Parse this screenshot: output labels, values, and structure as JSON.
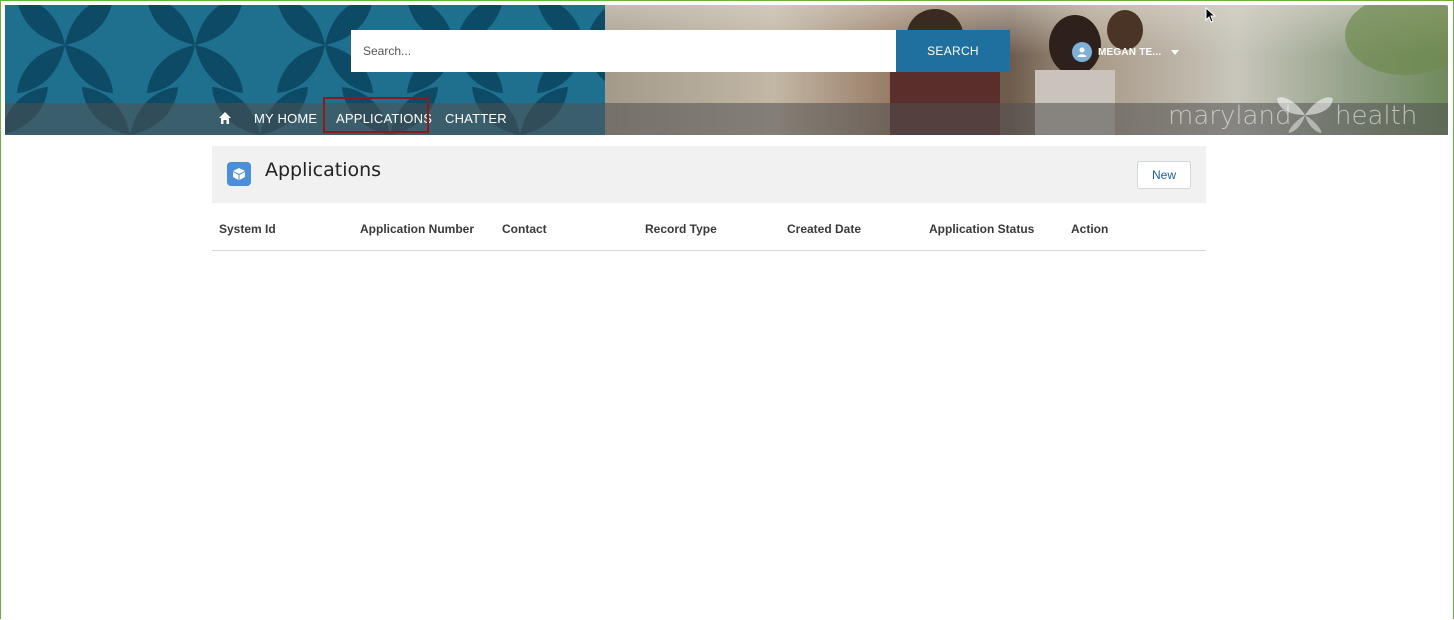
{
  "header": {
    "search": {
      "placeholder": "Search...",
      "button_label": "SEARCH"
    },
    "user": {
      "name": "MEGAN TE...",
      "icon": "user-avatar-icon"
    },
    "logo": {
      "word1": "maryland",
      "word2": "health"
    }
  },
  "nav": {
    "home_icon": "home-icon",
    "items": [
      {
        "label": "MY HOME"
      },
      {
        "label": "APPLICATIONS",
        "active": true
      },
      {
        "label": "CHATTER"
      }
    ]
  },
  "main": {
    "title": "Applications",
    "title_icon": "applications-cube-icon",
    "new_button_label": "New",
    "table": {
      "columns": [
        "System Id",
        "Application Number",
        "Contact",
        "Record Type",
        "Created Date",
        "Application Status",
        "Action"
      ],
      "rows": []
    }
  },
  "colors": {
    "frame_border": "#6ab23e",
    "search_button": "#1f6f9f",
    "banner_pattern_bg": "#1f6f8e",
    "active_nav_outline": "#8b1a1a",
    "new_button_text": "#1d5fa0"
  }
}
